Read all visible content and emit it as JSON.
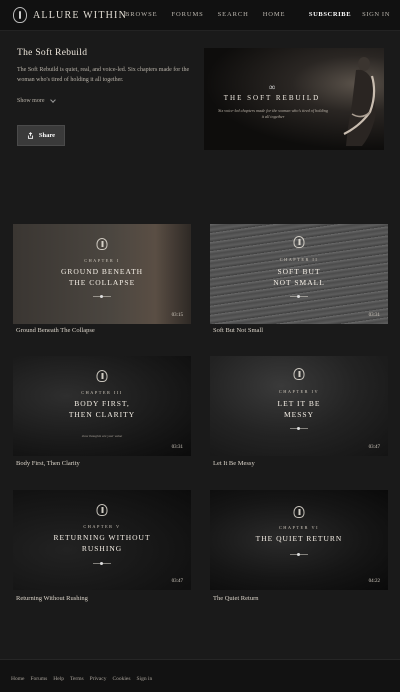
{
  "header": {
    "brand": "ALLURE WITHIN",
    "nav": [
      "BROWSE",
      "FORUMS",
      "SEARCH",
      "HOME"
    ],
    "subscribe": "SUBSCRIBE",
    "signin": "SIGN IN"
  },
  "intro": {
    "title": "The Soft Rebuild",
    "description": "The Soft Rebuild is quiet, real, and voice-led. Six chapters made for the woman who's tired of holding it all together.",
    "show_more": "Show more",
    "share": "Share"
  },
  "hero": {
    "symbol": "∞",
    "title": "THE SOFT REBUILD",
    "subtitle": "Six voice-led chapters made for the woman who's tired of holding it all together"
  },
  "chapters": [
    {
      "chapter": "CHAPTER I",
      "title_line1": "GROUND BENEATH",
      "title_line2": "THE COLLAPSE",
      "duration": "03:15",
      "label": "Ground Beneath The Collapse"
    },
    {
      "chapter": "CHAPTER II",
      "title_line1": "SOFT BUT",
      "title_line2": "NOT SMALL",
      "duration": "03:31",
      "label": "Soft But Not Small"
    },
    {
      "chapter": "CHAPTER III",
      "title_line1": "BODY FIRST,",
      "title_line2": "THEN CLARITY",
      "small": "slow thoughts are your value",
      "duration": "03:31",
      "label": "Body First, Then Clarity"
    },
    {
      "chapter": "CHAPTER IV",
      "title_line1": "LET IT BE",
      "title_line2": "MESSY",
      "duration": "03:47",
      "label": "Let It Be Messy"
    },
    {
      "chapter": "CHAPTER V",
      "title_line1": "RETURNING WITHOUT",
      "title_line2": "RUSHING",
      "duration": "03:47",
      "label": "Returning Without Rushing"
    },
    {
      "chapter": "CHAPTER VI",
      "title_line1": "THE QUIET RETURN",
      "title_line2": "",
      "duration": "04:22",
      "label": "The Quiet Return"
    }
  ],
  "footer": {
    "links": [
      "Home",
      "Forums",
      "Help",
      "Terms",
      "Privacy",
      "Cookies",
      "Sign in"
    ]
  },
  "colors": {
    "page_bg": "#1a1a1a",
    "header_bg": "#111111",
    "button_bg": "#3a3a3a"
  },
  "icons": [
    "allure-logo-icon",
    "chevron-down-icon",
    "share-icon",
    "chapter-emblem-icon"
  ]
}
